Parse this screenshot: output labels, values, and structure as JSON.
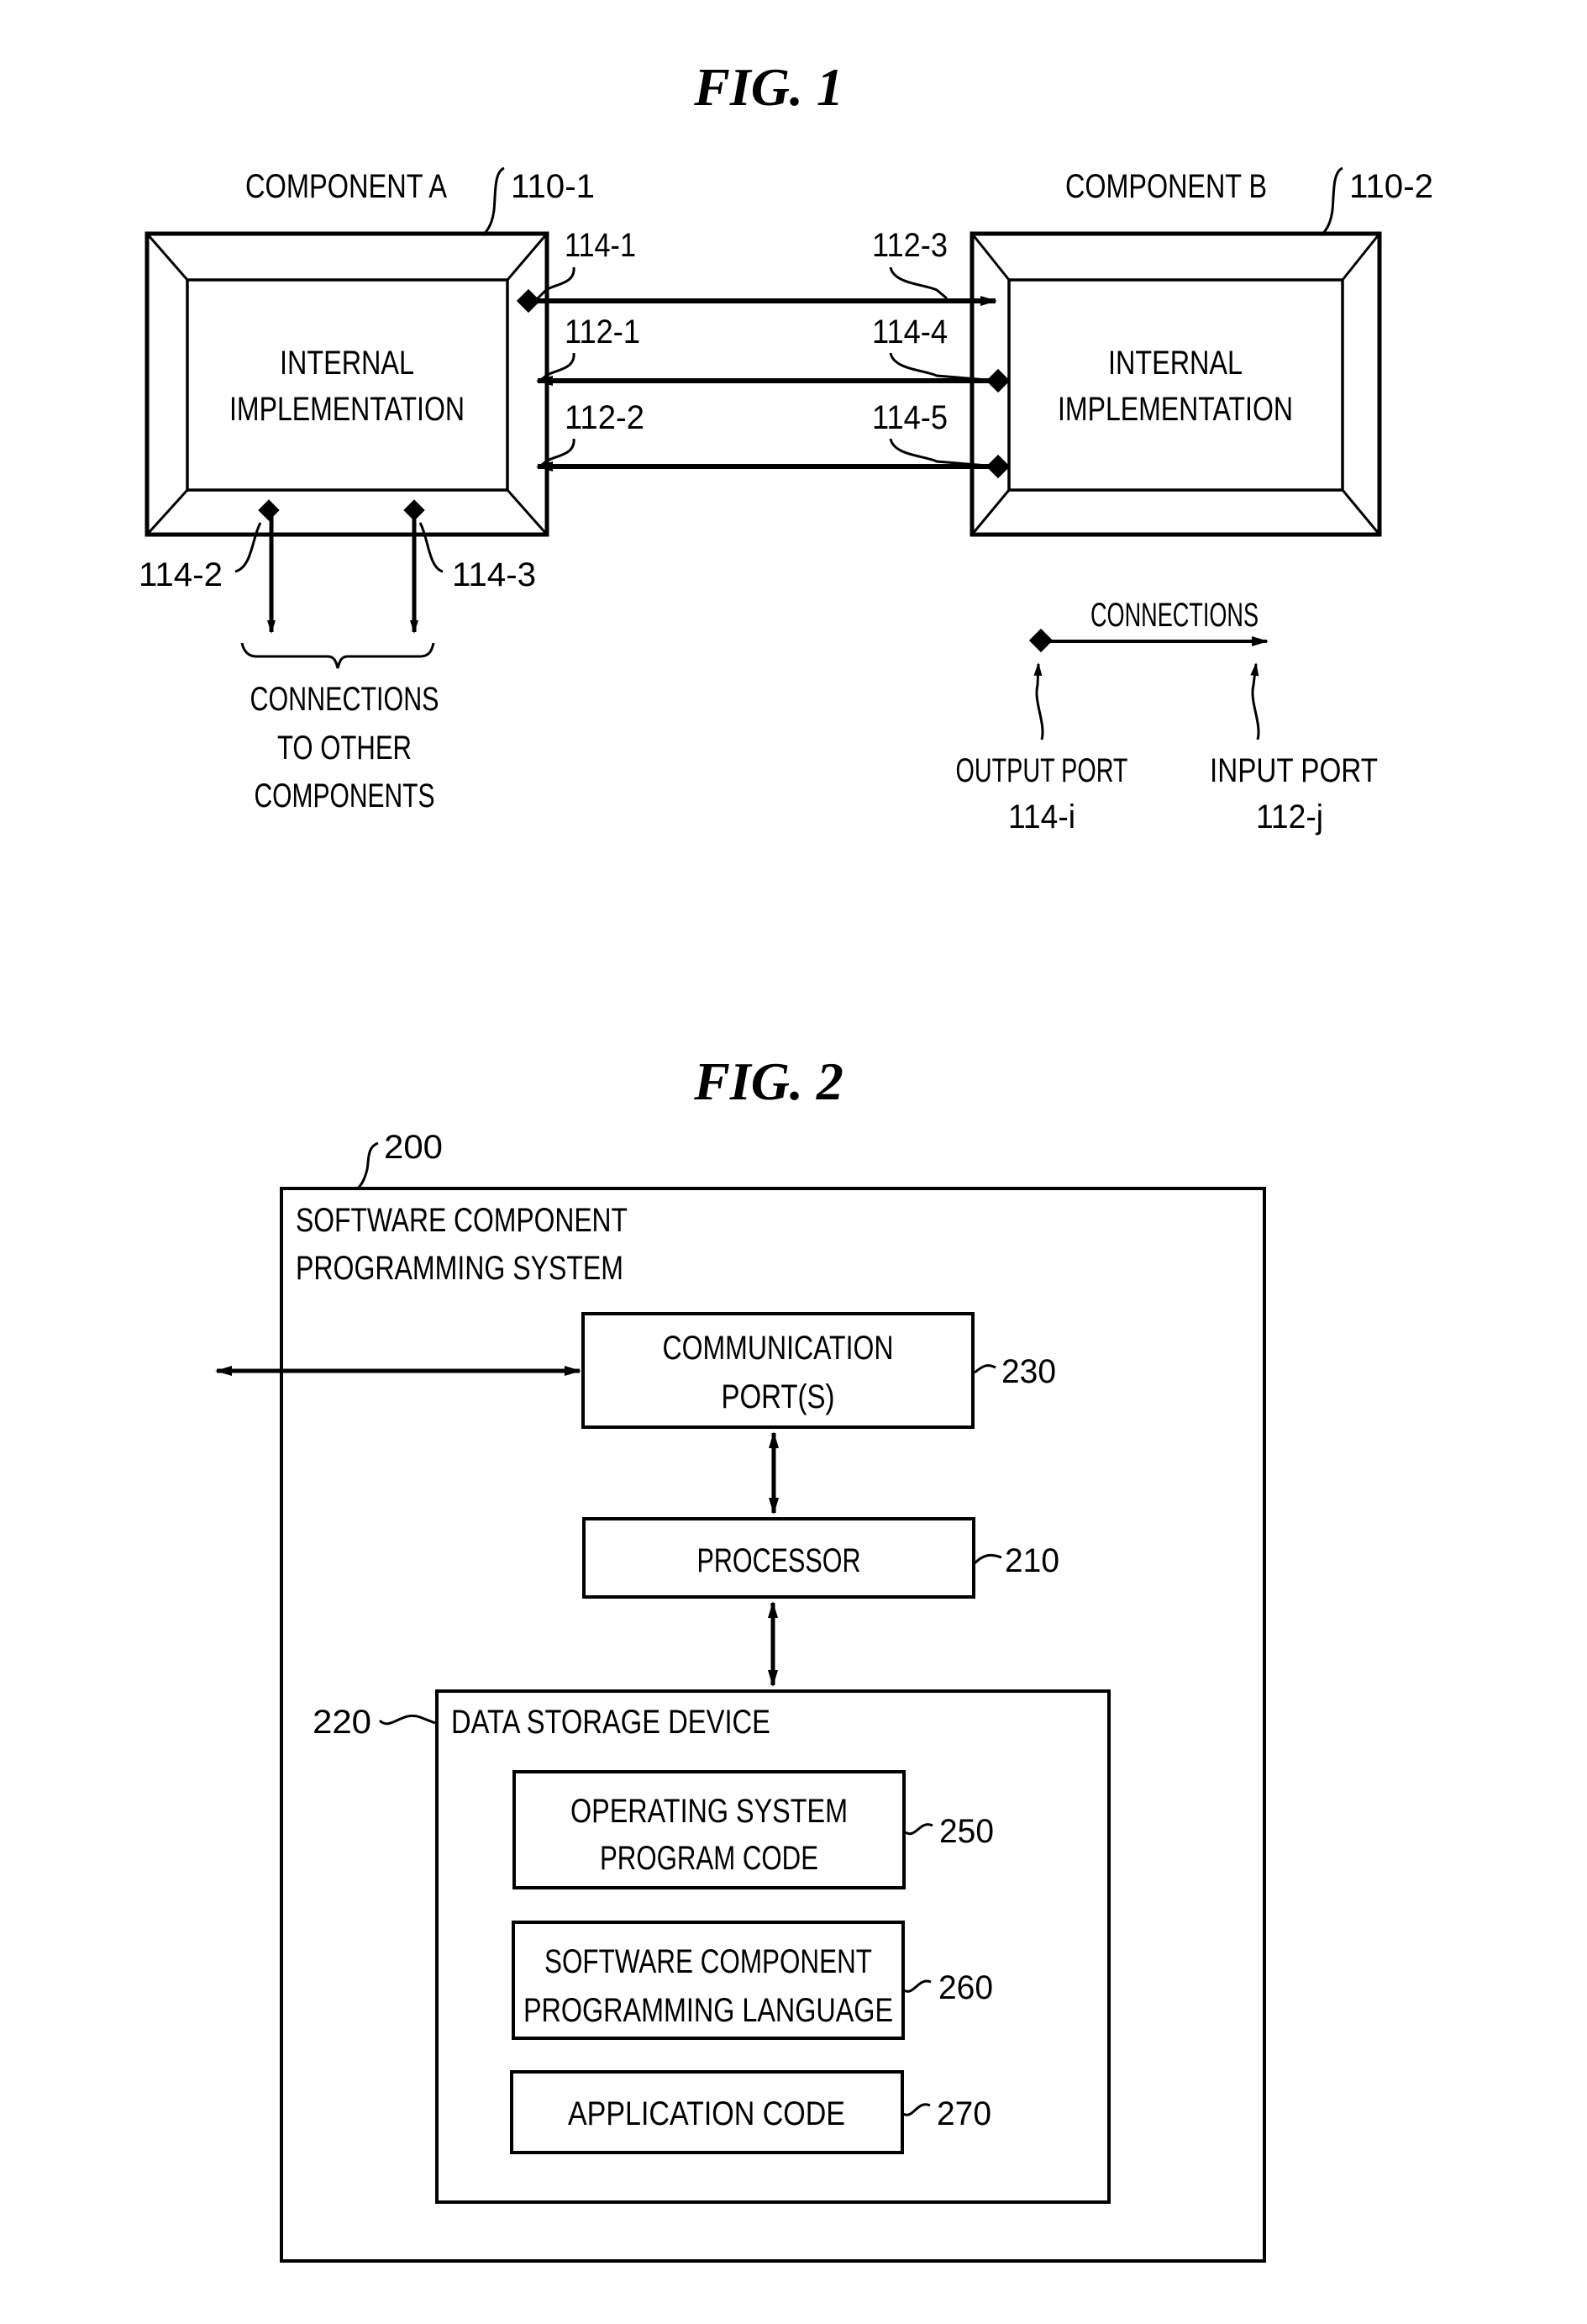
{
  "figure1": {
    "title": "FIG. 1",
    "component_a": {
      "name": "COMPONENT A",
      "ref": "110-1",
      "body_line1": "INTERNAL",
      "body_line2": "IMPLEMENTATION"
    },
    "component_b": {
      "name": "COMPONENT B",
      "ref": "110-2",
      "body_line1": "INTERNAL",
      "body_line2": "IMPLEMENTATION"
    },
    "connections": [
      {
        "left_label": "114-1",
        "right_label": "112-3",
        "direction": "A-to-B"
      },
      {
        "left_label": "112-1",
        "right_label": "114-4",
        "direction": "B-to-A"
      },
      {
        "left_label": "112-2",
        "right_label": "114-5",
        "direction": "B-to-A"
      }
    ],
    "bottom_ports": [
      {
        "label": "114-2"
      },
      {
        "label": "114-3"
      }
    ],
    "other_components_caption": [
      "CONNECTIONS",
      "TO OTHER",
      "COMPONENTS"
    ],
    "legend": {
      "title": "CONNECTIONS",
      "output_port_label": "OUTPUT PORT",
      "output_port_ref": "114-i",
      "input_port_label": "INPUT PORT",
      "input_port_ref": "112-j"
    }
  },
  "figure2": {
    "title": "FIG. 2",
    "system": {
      "ref": "200",
      "line1": "SOFTWARE COMPONENT",
      "line2": "PROGRAMMING SYSTEM"
    },
    "communication_ports": {
      "line1": "COMMUNICATION",
      "line2": "PORT(S)",
      "ref": "230"
    },
    "processor": {
      "label": "PROCESSOR",
      "ref": "210"
    },
    "data_storage": {
      "label": "DATA STORAGE DEVICE",
      "ref": "220"
    },
    "storage_items": [
      {
        "line1": "OPERATING SYSTEM",
        "line2": "PROGRAM CODE",
        "ref": "250"
      },
      {
        "line1": "SOFTWARE COMPONENT",
        "line2": "PROGRAMMING LANGUAGE",
        "ref": "260"
      },
      {
        "line1": "APPLICATION CODE",
        "line2": "",
        "ref": "270"
      }
    ]
  }
}
